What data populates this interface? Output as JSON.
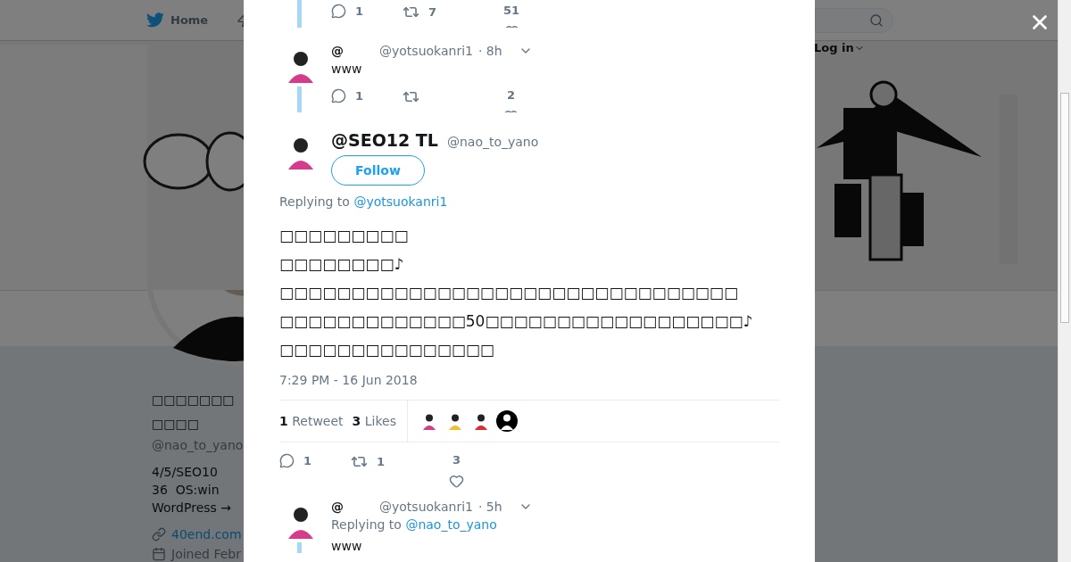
{
  "background_page": {
    "nav": {
      "home": "Home"
    },
    "log_in": "Log in",
    "profile": {
      "name_lines": [
        "□□□□□□□",
        "□□□□"
      ],
      "handle": "@nao_to_yano",
      "bio": [
        "4/5/SEO10",
        "36  OS:win",
        "WordPress →"
      ],
      "link": "40end.com",
      "joined": "Joined Febr"
    }
  },
  "conversation": [
    {
      "kind": "actions",
      "actions": {
        "replies": "1",
        "retweets": "7",
        "likes": "51"
      }
    },
    {
      "kind": "reply",
      "name": "@",
      "handle": "@yotsuokanri1",
      "time": "· 8h",
      "text": "www",
      "actions": {
        "replies": "1",
        "likes": "2"
      }
    },
    {
      "kind": "main",
      "name": "@SEO12 TL",
      "handle": "@nao_to_yano",
      "follow": "Follow",
      "replying_to": {
        "label": "Replying to",
        "handle": "@yotsuokanri1"
      },
      "text_lines": [
        "□□□□□□□□□",
        "□□□□□□□□♪",
        "□□□□□□□□□□□□□□□□□□□□□□□□□□□□□□□□",
        "□□□□□□□□□□□□□50□□□□□□□□□□□□□□□□□□♪",
        "□□□□□□□□□□□□□□□"
      ],
      "timestamp": "7:29 PM - 16 Jun 2018",
      "stats": {
        "retweets": "1",
        "retweets_label": "Retweet",
        "likes": "3",
        "likes_label": "Likes"
      },
      "actions": {
        "replies": "1",
        "retweets": "1",
        "likes": "3"
      }
    },
    {
      "kind": "reply",
      "name": "@",
      "handle": "@yotsuokanri1",
      "time": "· 5h",
      "replying_to": {
        "label": "Replying to",
        "handle": "@nao_to_yano"
      },
      "text": "www"
    }
  ]
}
